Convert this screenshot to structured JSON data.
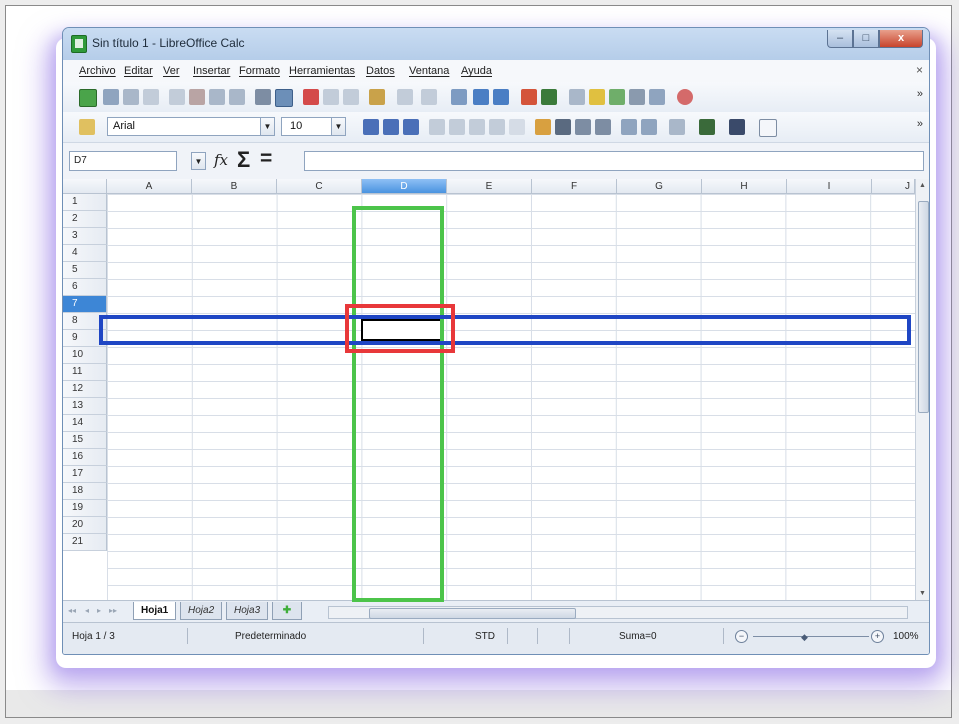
{
  "window": {
    "title": "Sin título 1 - LibreOffice Calc",
    "minimize": "–",
    "maximize": "□",
    "close": "x"
  },
  "menu": {
    "items": [
      "Archivo",
      "Editar",
      "Ver",
      "Insertar",
      "Formato",
      "Herramientas",
      "Datos",
      "Ventana",
      "Ayuda"
    ],
    "close": "×"
  },
  "toolbar": {
    "overflow": "»",
    "font_name": "Arial",
    "font_size": "10",
    "dropdown_glyph": "▼"
  },
  "formula_bar": {
    "name_box": "D7",
    "fx": "fx",
    "sum": "Σ",
    "equals": "=",
    "input": ""
  },
  "grid": {
    "columns": [
      "A",
      "B",
      "C",
      "D",
      "E",
      "F",
      "G",
      "H",
      "I",
      "J"
    ],
    "rows": [
      "1",
      "2",
      "3",
      "4",
      "5",
      "6",
      "7",
      "8",
      "9",
      "10",
      "11",
      "12",
      "13",
      "14",
      "15",
      "16",
      "17",
      "18",
      "19",
      "20",
      "21"
    ],
    "active_column": "D",
    "active_row": "7"
  },
  "sheets": {
    "tabs": [
      "Hoja1",
      "Hoja2",
      "Hoja3"
    ],
    "active": "Hoja1",
    "nav": [
      "◂◂",
      "◂",
      "▸",
      "▸▸"
    ]
  },
  "status": {
    "sheet": "Hoja 1 / 3",
    "style": "Predeterminado",
    "mode": "STD",
    "sum": "Suma=0",
    "zoom": "100%"
  },
  "colors": {
    "column_highlight": "#4cc44a",
    "row_highlight": "#1f46c4",
    "cell_highlight": "#e8383a"
  }
}
